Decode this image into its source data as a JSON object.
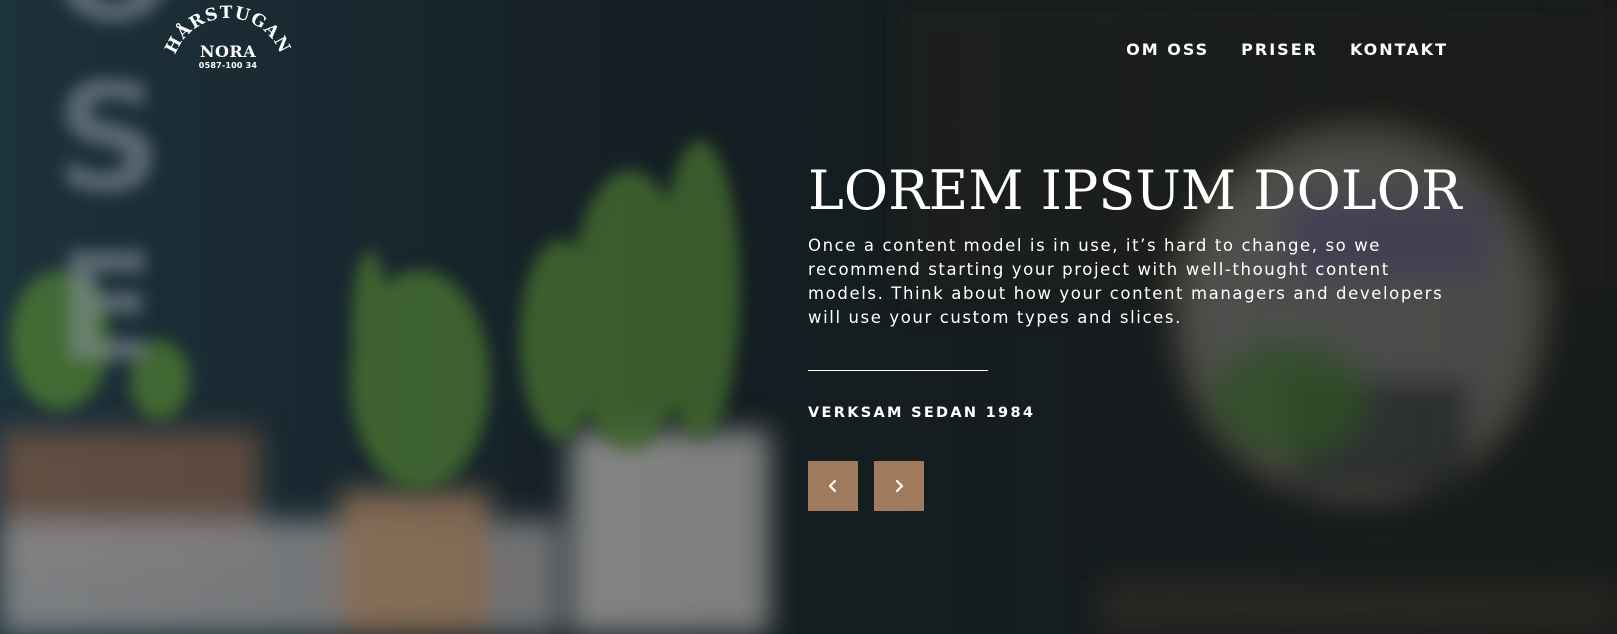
{
  "logo": {
    "arc_text": "HÅRSTUGAN",
    "name": "NORA",
    "phone": "0587-100 34"
  },
  "nav": {
    "items": [
      {
        "label": "OM OSS"
      },
      {
        "label": "PRISER"
      },
      {
        "label": "KONTAKT"
      }
    ]
  },
  "hero": {
    "title": "LOREM IPSUM DOLOR",
    "description": "Once a content model is in use, it’s hard to change, so we recommend starting your project with well-thought content models. Think about how your content managers and developers will use your custom types and slices.",
    "tagline": "VERKSAM SEDAN 1984"
  },
  "slider": {
    "prev_icon": "chevron-left-icon",
    "next_icon": "chevron-right-icon"
  },
  "colors": {
    "accent": "#a07a5d",
    "text": "#ffffff",
    "background": "#1c2427"
  }
}
